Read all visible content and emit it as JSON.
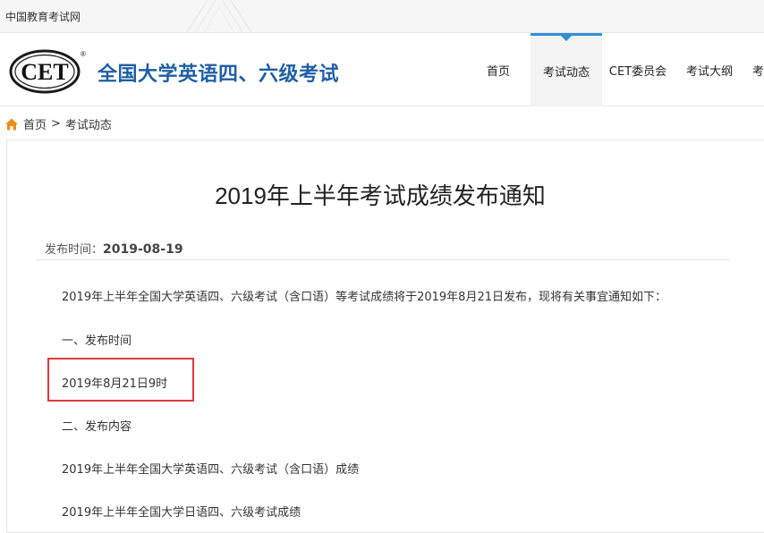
{
  "topbar": {
    "site_name": "中国教育考试网"
  },
  "header": {
    "logo_text": "CET",
    "logo_registered": "®",
    "title": "全国大学英语四、六级考试",
    "nav": [
      {
        "label": "首页",
        "active": false
      },
      {
        "label": "考试动态",
        "active": true
      },
      {
        "label": "CET委员会",
        "active": false
      },
      {
        "label": "考试大纲",
        "active": false
      },
      {
        "label": "考",
        "active": false
      }
    ],
    "accent_color": "#2f8fd8",
    "title_color": "#1f5fa3"
  },
  "breadcrumb": {
    "home": "首页",
    "separator": ">",
    "current": "考试动态"
  },
  "article": {
    "title": "2019年上半年考试成绩发布通知",
    "meta_label": "发布时间：",
    "date": "2019-08-19",
    "paragraphs": [
      "2019年上半年全国大学英语四、六级考试（含口语）等考试成绩将于2019年8月21日发布，现将有关事宜通知如下：",
      "一、发布时间",
      "2019年8月21日9时",
      "二、发布内容",
      "2019年上半年全国大学英语四、六级考试（含口语）成绩",
      "2019年上半年全国大学日语四、六级考试成绩"
    ],
    "highlight_color": "#e0393e"
  }
}
